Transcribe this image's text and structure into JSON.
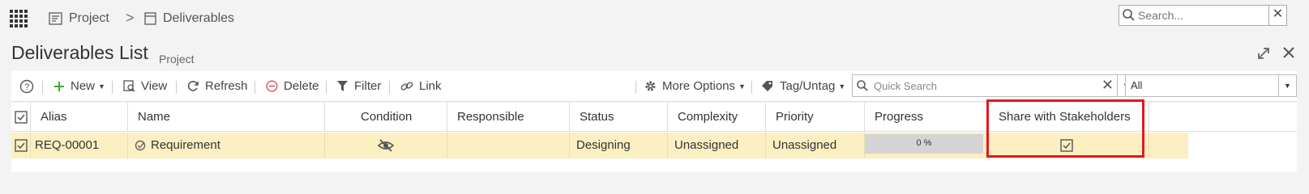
{
  "breadcrumb": {
    "project": "Project",
    "separator": ">",
    "deliverables": "Deliverables"
  },
  "global_search": {
    "placeholder": "Search...",
    "clear": "✕"
  },
  "page": {
    "title": "Deliverables List",
    "subtitle": "Project"
  },
  "toolbar": {
    "new": "New",
    "view": "View",
    "refresh": "Refresh",
    "delete": "Delete",
    "filter": "Filter",
    "link": "Link",
    "more_options": "More Options",
    "tag_untag": "Tag/Untag",
    "quick_search_placeholder": "Quick Search",
    "scope_select": "All"
  },
  "columns": [
    "Alias",
    "Name",
    "Condition",
    "Responsible",
    "Status",
    "Complexity",
    "Priority",
    "Progress",
    "Share with Stakeholders"
  ],
  "rows": [
    {
      "alias": "REQ-00001",
      "name": "Requirement",
      "responsible": "",
      "status": "Designing",
      "complexity": "Unassigned",
      "priority": "Unassigned",
      "progress": "0 %",
      "progress_value": 0
    }
  ],
  "colors": {
    "row_selected": "#fcefc2",
    "highlight": "#e01a22",
    "toolbar_new": "#3aaa35",
    "delete": "#d9534f"
  }
}
